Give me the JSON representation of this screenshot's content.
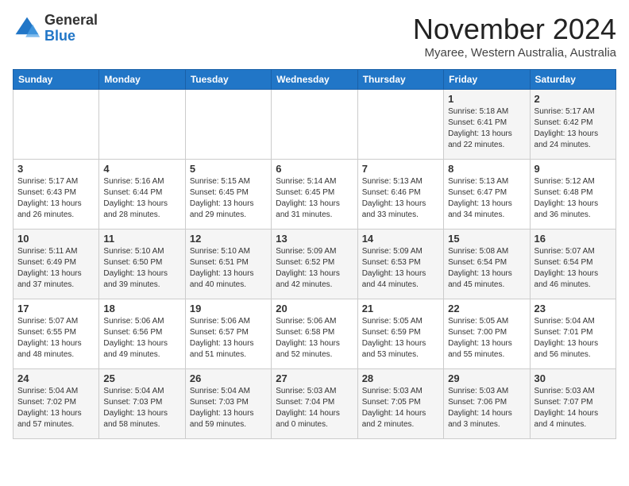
{
  "header": {
    "logo_general": "General",
    "logo_blue": "Blue",
    "month_title": "November 2024",
    "location": "Myaree, Western Australia, Australia"
  },
  "days_of_week": [
    "Sunday",
    "Monday",
    "Tuesday",
    "Wednesday",
    "Thursday",
    "Friday",
    "Saturday"
  ],
  "weeks": [
    [
      {
        "day": "",
        "info": ""
      },
      {
        "day": "",
        "info": ""
      },
      {
        "day": "",
        "info": ""
      },
      {
        "day": "",
        "info": ""
      },
      {
        "day": "",
        "info": ""
      },
      {
        "day": "1",
        "info": "Sunrise: 5:18 AM\nSunset: 6:41 PM\nDaylight: 13 hours\nand 22 minutes."
      },
      {
        "day": "2",
        "info": "Sunrise: 5:17 AM\nSunset: 6:42 PM\nDaylight: 13 hours\nand 24 minutes."
      }
    ],
    [
      {
        "day": "3",
        "info": "Sunrise: 5:17 AM\nSunset: 6:43 PM\nDaylight: 13 hours\nand 26 minutes."
      },
      {
        "day": "4",
        "info": "Sunrise: 5:16 AM\nSunset: 6:44 PM\nDaylight: 13 hours\nand 28 minutes."
      },
      {
        "day": "5",
        "info": "Sunrise: 5:15 AM\nSunset: 6:45 PM\nDaylight: 13 hours\nand 29 minutes."
      },
      {
        "day": "6",
        "info": "Sunrise: 5:14 AM\nSunset: 6:45 PM\nDaylight: 13 hours\nand 31 minutes."
      },
      {
        "day": "7",
        "info": "Sunrise: 5:13 AM\nSunset: 6:46 PM\nDaylight: 13 hours\nand 33 minutes."
      },
      {
        "day": "8",
        "info": "Sunrise: 5:13 AM\nSunset: 6:47 PM\nDaylight: 13 hours\nand 34 minutes."
      },
      {
        "day": "9",
        "info": "Sunrise: 5:12 AM\nSunset: 6:48 PM\nDaylight: 13 hours\nand 36 minutes."
      }
    ],
    [
      {
        "day": "10",
        "info": "Sunrise: 5:11 AM\nSunset: 6:49 PM\nDaylight: 13 hours\nand 37 minutes."
      },
      {
        "day": "11",
        "info": "Sunrise: 5:10 AM\nSunset: 6:50 PM\nDaylight: 13 hours\nand 39 minutes."
      },
      {
        "day": "12",
        "info": "Sunrise: 5:10 AM\nSunset: 6:51 PM\nDaylight: 13 hours\nand 40 minutes."
      },
      {
        "day": "13",
        "info": "Sunrise: 5:09 AM\nSunset: 6:52 PM\nDaylight: 13 hours\nand 42 minutes."
      },
      {
        "day": "14",
        "info": "Sunrise: 5:09 AM\nSunset: 6:53 PM\nDaylight: 13 hours\nand 44 minutes."
      },
      {
        "day": "15",
        "info": "Sunrise: 5:08 AM\nSunset: 6:54 PM\nDaylight: 13 hours\nand 45 minutes."
      },
      {
        "day": "16",
        "info": "Sunrise: 5:07 AM\nSunset: 6:54 PM\nDaylight: 13 hours\nand 46 minutes."
      }
    ],
    [
      {
        "day": "17",
        "info": "Sunrise: 5:07 AM\nSunset: 6:55 PM\nDaylight: 13 hours\nand 48 minutes."
      },
      {
        "day": "18",
        "info": "Sunrise: 5:06 AM\nSunset: 6:56 PM\nDaylight: 13 hours\nand 49 minutes."
      },
      {
        "day": "19",
        "info": "Sunrise: 5:06 AM\nSunset: 6:57 PM\nDaylight: 13 hours\nand 51 minutes."
      },
      {
        "day": "20",
        "info": "Sunrise: 5:06 AM\nSunset: 6:58 PM\nDaylight: 13 hours\nand 52 minutes."
      },
      {
        "day": "21",
        "info": "Sunrise: 5:05 AM\nSunset: 6:59 PM\nDaylight: 13 hours\nand 53 minutes."
      },
      {
        "day": "22",
        "info": "Sunrise: 5:05 AM\nSunset: 7:00 PM\nDaylight: 13 hours\nand 55 minutes."
      },
      {
        "day": "23",
        "info": "Sunrise: 5:04 AM\nSunset: 7:01 PM\nDaylight: 13 hours\nand 56 minutes."
      }
    ],
    [
      {
        "day": "24",
        "info": "Sunrise: 5:04 AM\nSunset: 7:02 PM\nDaylight: 13 hours\nand 57 minutes."
      },
      {
        "day": "25",
        "info": "Sunrise: 5:04 AM\nSunset: 7:03 PM\nDaylight: 13 hours\nand 58 minutes."
      },
      {
        "day": "26",
        "info": "Sunrise: 5:04 AM\nSunset: 7:03 PM\nDaylight: 13 hours\nand 59 minutes."
      },
      {
        "day": "27",
        "info": "Sunrise: 5:03 AM\nSunset: 7:04 PM\nDaylight: 14 hours\nand 0 minutes."
      },
      {
        "day": "28",
        "info": "Sunrise: 5:03 AM\nSunset: 7:05 PM\nDaylight: 14 hours\nand 2 minutes."
      },
      {
        "day": "29",
        "info": "Sunrise: 5:03 AM\nSunset: 7:06 PM\nDaylight: 14 hours\nand 3 minutes."
      },
      {
        "day": "30",
        "info": "Sunrise: 5:03 AM\nSunset: 7:07 PM\nDaylight: 14 hours\nand 4 minutes."
      }
    ]
  ]
}
